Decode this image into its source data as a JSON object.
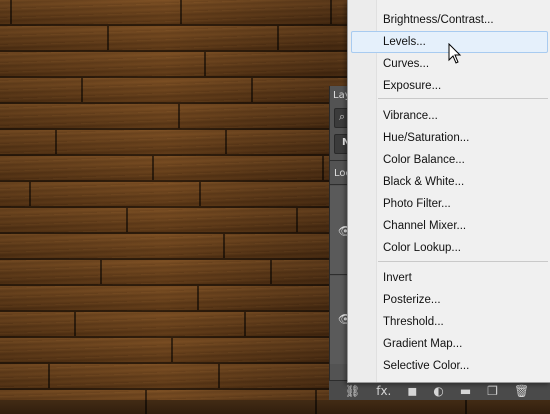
{
  "layers_panel": {
    "tab_label": "Lay",
    "search_glyph": "⌕",
    "mode_label": "N",
    "lock_label": "Loc",
    "eye_glyph": "👁",
    "footer_icons": [
      "link-icon",
      "fx-icon",
      "mask-icon",
      "adjustment-icon",
      "folder-icon",
      "new-layer-icon",
      "trash-icon"
    ],
    "footer_glyphs": [
      "⛓",
      "fx.",
      "◼",
      "◐",
      "▬",
      "❐",
      "🗑"
    ]
  },
  "menu": {
    "groups": [
      [
        "Brightness/Contrast...",
        "Levels...",
        "Curves...",
        "Exposure..."
      ],
      [
        "Vibrance...",
        "Hue/Saturation...",
        "Color Balance...",
        "Black & White...",
        "Photo Filter...",
        "Channel Mixer...",
        "Color Lookup..."
      ],
      [
        "Invert",
        "Posterize...",
        "Threshold...",
        "Gradient Map...",
        "Selective Color..."
      ]
    ],
    "highlighted": "Levels..."
  }
}
